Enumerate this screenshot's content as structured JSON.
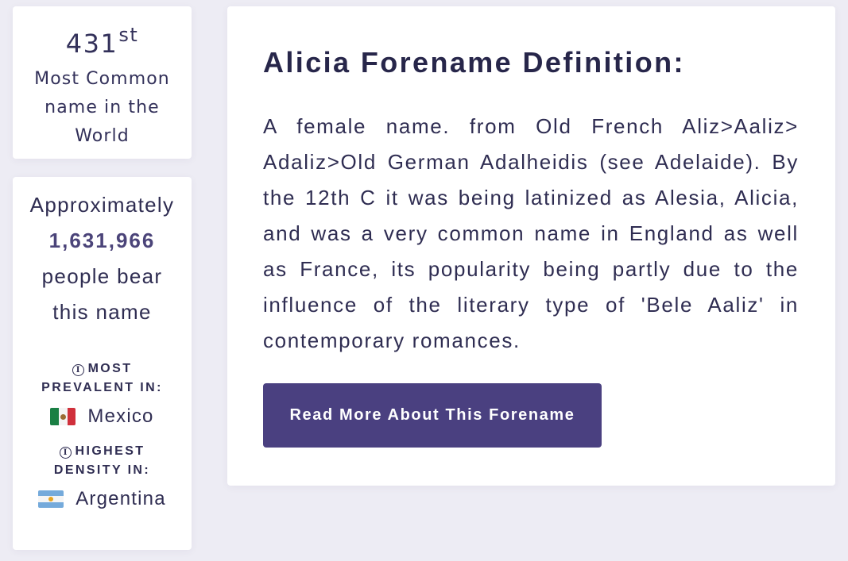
{
  "rank": {
    "number": "431",
    "suffix": "st",
    "caption": "Most Common name in the World"
  },
  "stats": {
    "prefix": "Approximately",
    "count": "1,631,966",
    "suffix_line1": "people bear",
    "suffix_line2": "this name",
    "most_prevalent": {
      "label_line1": "MOST",
      "label_line2": "PREVALENT IN:",
      "country": "Mexico",
      "flag_icon": "mexico-flag-icon"
    },
    "highest_density": {
      "label_line1": "HIGHEST",
      "label_line2": "DENSITY IN:",
      "country": "Argentina",
      "flag_icon": "argentina-flag-icon"
    },
    "info_icon": "i"
  },
  "definition": {
    "title": "Alicia Forename Definition:",
    "body": "A female name. from Old French Aliz>Aaliz> Adaliz>Old German Adalheidis (see Adelaide). By the 12th C it was being latinized as Alesia, Alicia, and was a very common name in England as well as France, its popularity being partly due to the influence of the literary type of 'Bele Aaliz' in contemporary romances.",
    "button_label": "Read More About This Forename"
  },
  "colors": {
    "background": "#edecf4",
    "card": "#ffffff",
    "text": "#2b2a4c",
    "accent": "#4a4080"
  }
}
